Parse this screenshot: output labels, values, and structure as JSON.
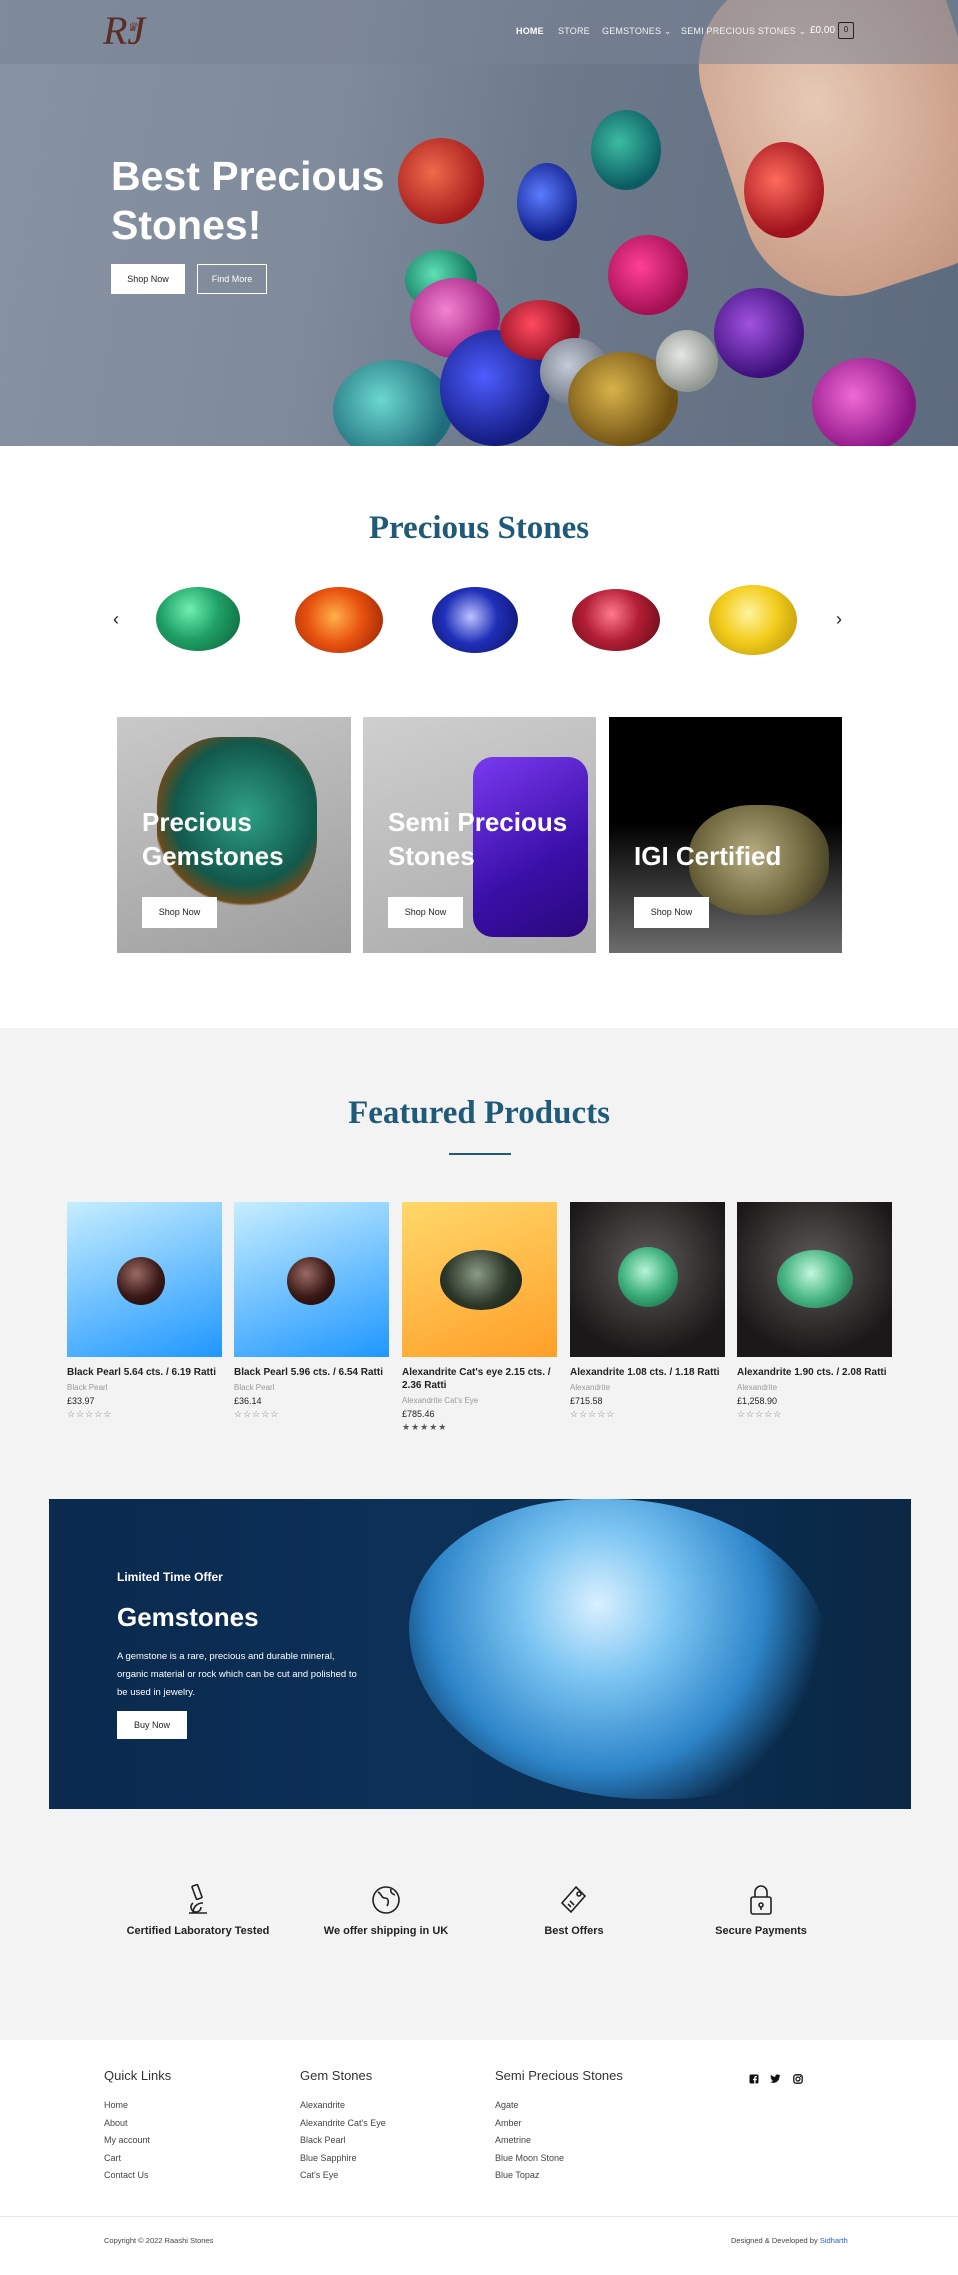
{
  "header": {
    "logo_text": "RJ",
    "nav": [
      {
        "label": "HOME",
        "active": true
      },
      {
        "label": "STORE"
      },
      {
        "label": "GEMSTONES",
        "dropdown": true
      },
      {
        "label": "SEMI PRECIOUS STONES",
        "dropdown": true
      }
    ],
    "cart_amount": "£0.00",
    "cart_count": "0"
  },
  "hero": {
    "title": "Best Precious Stones!",
    "primary_button": "Shop Now",
    "secondary_button": "Find More"
  },
  "precious": {
    "title": "Precious Stones",
    "prev_icon": "chevron-left-icon",
    "next_icon": "chevron-right-icon",
    "stones": [
      {
        "name": "emerald",
        "color": "#1fa066"
      },
      {
        "name": "orange-sapphire",
        "color": "#e8520f"
      },
      {
        "name": "blue-sapphire",
        "color": "#1f2fb8"
      },
      {
        "name": "ruby",
        "color": "#b21e35"
      },
      {
        "name": "yellow-sapphire",
        "color": "#f2cc1c"
      }
    ]
  },
  "categories": [
    {
      "title": "Precious Gemstones",
      "button": "Shop Now"
    },
    {
      "title": "Semi Precious Stones",
      "button": "Shop Now"
    },
    {
      "title": "IGI Certified",
      "button": "Shop Now"
    }
  ],
  "featured": {
    "title": "Featured Products",
    "products": [
      {
        "name": "Black Pearl 5.64 cts. / 6.19 Ratti",
        "category": "Black Pearl",
        "price": "£33.97",
        "stars": "☆☆☆☆☆",
        "rated": false
      },
      {
        "name": "Black Pearl 5.96 cts. / 6.54 Ratti",
        "category": "Black Pearl",
        "price": "£36.14",
        "stars": "☆☆☆☆☆",
        "rated": false
      },
      {
        "name": "Alexandrite Cat's eye 2.15 cts. / 2.36 Ratti",
        "category": "Alexandrite Cat's Eye",
        "price": "£785.46",
        "stars": "★★★★★",
        "rated": true
      },
      {
        "name": "Alexandrite 1.08 cts. / 1.18 Ratti",
        "category": "Alexandrite",
        "price": "£715.58",
        "stars": "☆☆☆☆☆",
        "rated": false
      },
      {
        "name": "Alexandrite 1.90 cts. / 2.08 Ratti",
        "category": "Alexandrite",
        "price": "£1,258.90",
        "stars": "☆☆☆☆☆",
        "rated": false
      }
    ]
  },
  "offer": {
    "label": "Limited Time Offer",
    "title": "Gemstones",
    "text": "A gemstone is a rare, precious and durable mineral, organic material or rock which can be cut and polished to be used in jewelry.",
    "button": "Buy Now"
  },
  "features": [
    {
      "icon": "microscope-icon",
      "label": "Certified Laboratory Tested"
    },
    {
      "icon": "globe-icon",
      "label": "We offer shipping in UK"
    },
    {
      "icon": "price-tag-icon",
      "label": "Best Offers"
    },
    {
      "icon": "lock-icon",
      "label": "Secure Payments"
    }
  ],
  "footer": {
    "columns": [
      {
        "heading": "Quick Links",
        "links": [
          "Home",
          "About",
          "My account",
          "Cart",
          "Contact Us"
        ]
      },
      {
        "heading": "Gem Stones",
        "links": [
          "Alexandrite",
          "Alexandrite Cat's Eye",
          "Black Pearl",
          "Blue Sapphire",
          "Cat's Eye"
        ]
      },
      {
        "heading": "Semi Precious Stones",
        "links": [
          "Agate",
          "Amber",
          "Ametrine",
          "Blue Moon Stone",
          "Blue Topaz"
        ]
      }
    ],
    "social": [
      "facebook-icon",
      "twitter-icon",
      "instagram-icon"
    ],
    "copyright": "Copyright © 2022 Raashi Stones",
    "credit_prefix": "Designed & Developed by",
    "credit_name": "Sidharth"
  }
}
